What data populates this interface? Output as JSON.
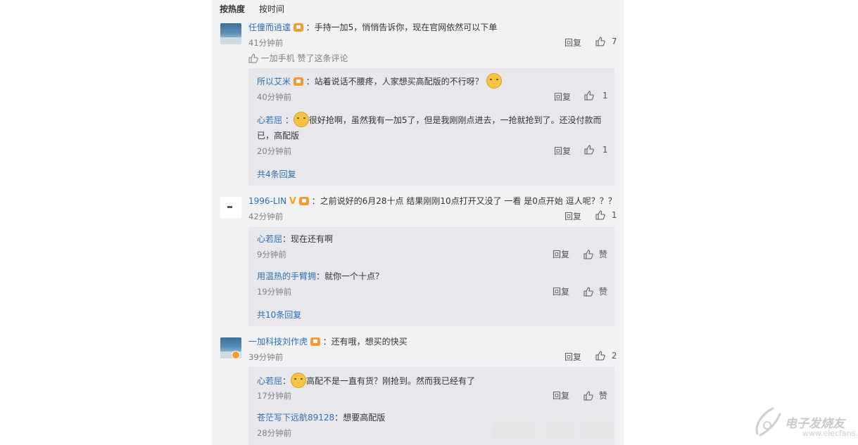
{
  "tabs": {
    "hot": "按热度",
    "time": "按时间"
  },
  "actions": {
    "reply": "回复",
    "like": "赞"
  },
  "comments": [
    {
      "user": "任僮而逍遑",
      "text": "：手持一加5，悄悄告诉你，现在官网依然可以下单",
      "time": "41分钟前",
      "likes": "7",
      "liked_by": "一加手机 赞了这条评论",
      "replies": [
        {
          "user": "所以艾米",
          "text": "：站着说话不腰疼，人家想买高配版的不行呀？",
          "time": "40分钟前",
          "likes": "1"
        },
        {
          "user": "心若屈",
          "text_line1": "很好抢啊，虽然我有一加5了，但是我刚刚点进去，一抢就抢到了。还没付款而",
          "text_line2": "已，高配版",
          "time": "20分钟前",
          "likes": "1"
        }
      ],
      "more": "共4条回复"
    },
    {
      "user": "1996-LIN",
      "text": "：之前说好的6月28十点 结果刚刚10点打开又没了 一看 是0点开始 逗人呢？？？",
      "time": "42分钟前",
      "likes": "1",
      "replies": [
        {
          "user": "心若屈",
          "text": "：现在还有啊",
          "time": "9分钟前",
          "likes": "赞"
        },
        {
          "user": "用温热的手臂拥",
          "text": "：就你一个十点？",
          "time": "19分钟前",
          "likes": "赞"
        }
      ],
      "more": "共10条回复"
    },
    {
      "user": "一加科技刘作虎",
      "text": "：还有哦，想买的快买",
      "time": "39分钟前",
      "likes": "2",
      "replies": [
        {
          "user": "心若屈",
          "text": "高配不是一直有货？刚抢到。然而我已经有了",
          "time": "17分钟前",
          "likes": "赞"
        },
        {
          "user": "苍茫写下远航89128",
          "text": "：想要高配版",
          "time": "28分钟前"
        }
      ]
    }
  ],
  "watermark": {
    "text": "电子发烧友",
    "url": "www.elecfans.com"
  }
}
